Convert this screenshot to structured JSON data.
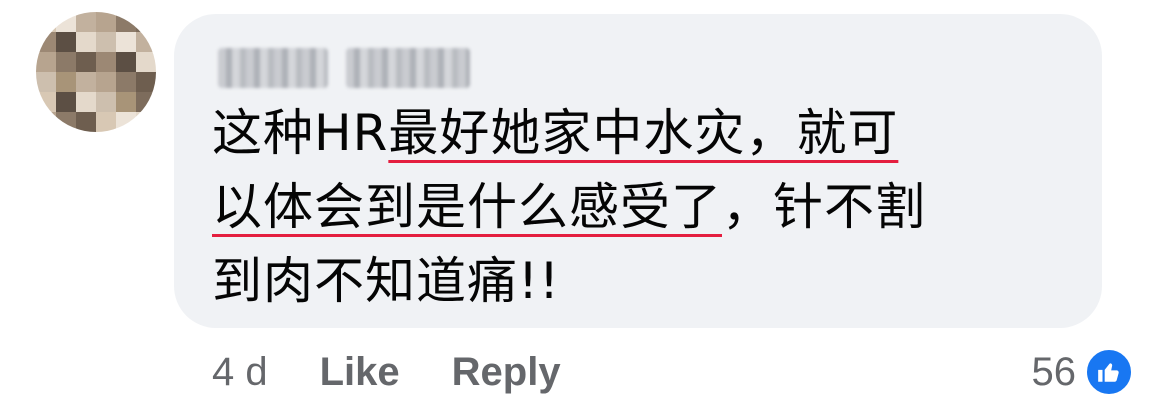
{
  "comment": {
    "author_name": "",
    "text_lines": [
      {
        "pre": "这种HR",
        "underlined": "最好她家中水灾，就可",
        "post": ""
      },
      {
        "pre": "",
        "underlined": "以体会到是什么感受了",
        "post": "，针不割"
      },
      {
        "pre": "到肉不知道痛!!",
        "underlined": "",
        "post": ""
      }
    ]
  },
  "actions": {
    "timestamp": "4 d",
    "like_label": "Like",
    "reply_label": "Reply"
  },
  "reactions": {
    "count": "56",
    "icon": "thumbs-up-icon"
  },
  "colors": {
    "bubble": "#f0f2f5",
    "underline": "#e41e3f",
    "reaction_blue": "#1877f2",
    "meta_text": "#65676b"
  }
}
